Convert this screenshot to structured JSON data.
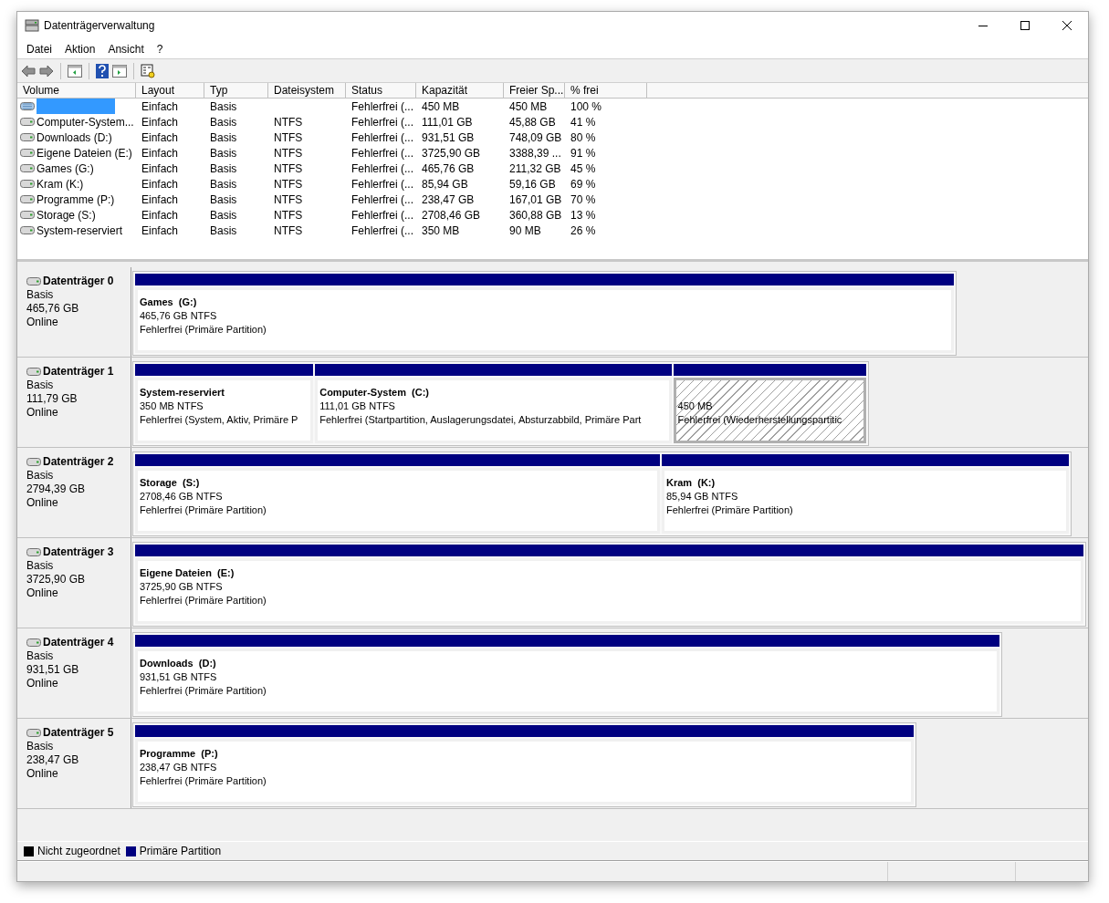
{
  "window": {
    "title": "Datenträgerverwaltung"
  },
  "menu": [
    "Datei",
    "Aktion",
    "Ansicht",
    "?"
  ],
  "volume_list": {
    "columns": [
      "Volume",
      "Layout",
      "Typ",
      "Dateisystem",
      "Status",
      "Kapazität",
      "Freier Sp...",
      "% frei"
    ],
    "rows": [
      {
        "selected": true,
        "kind": "recovery",
        "cells": [
          "",
          "Einfach",
          "Basis",
          "",
          "Fehlerfrei (...",
          "450 MB",
          "450 MB",
          "100 %"
        ]
      },
      {
        "selected": false,
        "kind": "drive",
        "cells": [
          "Computer-System...",
          "Einfach",
          "Basis",
          "NTFS",
          "Fehlerfrei (...",
          "111,01 GB",
          "45,88 GB",
          "41 %"
        ]
      },
      {
        "selected": false,
        "kind": "drive",
        "cells": [
          "Downloads (D:)",
          "Einfach",
          "Basis",
          "NTFS",
          "Fehlerfrei (...",
          "931,51 GB",
          "748,09 GB",
          "80 %"
        ]
      },
      {
        "selected": false,
        "kind": "drive",
        "cells": [
          "Eigene Dateien (E:)",
          "Einfach",
          "Basis",
          "NTFS",
          "Fehlerfrei (...",
          "3725,90 GB",
          "3388,39 ...",
          "91 %"
        ]
      },
      {
        "selected": false,
        "kind": "drive",
        "cells": [
          "Games (G:)",
          "Einfach",
          "Basis",
          "NTFS",
          "Fehlerfrei (...",
          "465,76 GB",
          "211,32 GB",
          "45 %"
        ]
      },
      {
        "selected": false,
        "kind": "drive",
        "cells": [
          "Kram (K:)",
          "Einfach",
          "Basis",
          "NTFS",
          "Fehlerfrei (...",
          "85,94 GB",
          "59,16 GB",
          "69 %"
        ]
      },
      {
        "selected": false,
        "kind": "drive",
        "cells": [
          "Programme (P:)",
          "Einfach",
          "Basis",
          "NTFS",
          "Fehlerfrei (...",
          "238,47 GB",
          "167,01 GB",
          "70 %"
        ]
      },
      {
        "selected": false,
        "kind": "drive",
        "cells": [
          "Storage (S:)",
          "Einfach",
          "Basis",
          "NTFS",
          "Fehlerfrei (...",
          "2708,46 GB",
          "360,88 GB",
          "13 %"
        ]
      },
      {
        "selected": false,
        "kind": "drive",
        "cells": [
          "System-reserviert",
          "Einfach",
          "Basis",
          "NTFS",
          "Fehlerfrei (...",
          "350 MB",
          "90 MB",
          "26 %"
        ]
      }
    ]
  },
  "disks": [
    {
      "name": "Datenträger 0",
      "type": "Basis",
      "size": "465,76 GB",
      "state": "Online",
      "partitions": [
        {
          "name": "Games  (G:)",
          "size": "465,76 GB NTFS",
          "status": "Fehlerfrei (Primäre Partition)",
          "selected": false
        }
      ]
    },
    {
      "name": "Datenträger 1",
      "type": "Basis",
      "size": "111,79 GB",
      "state": "Online",
      "partitions": [
        {
          "name": "System-reserviert",
          "size": "350 MB NTFS",
          "status": "Fehlerfrei (System, Aktiv, Primäre P",
          "selected": false
        },
        {
          "name": "Computer-System  (C:)",
          "size": "111,01 GB NTFS",
          "status": "Fehlerfrei (Startpartition, Auslagerungsdatei, Absturzabbild, Primäre Part",
          "selected": false
        },
        {
          "size": "450 MB",
          "status": "Fehlerfrei (Wiederherstellungspartitic",
          "selected": true
        }
      ]
    },
    {
      "name": "Datenträger 2",
      "type": "Basis",
      "size": "2794,39 GB",
      "state": "Online",
      "partitions": [
        {
          "name": "Storage  (S:)",
          "size": "2708,46 GB NTFS",
          "status": "Fehlerfrei (Primäre Partition)",
          "selected": false
        },
        {
          "name": "Kram  (K:)",
          "size": "85,94 GB NTFS",
          "status": "Fehlerfrei (Primäre Partition)",
          "selected": false
        }
      ]
    },
    {
      "name": "Datenträger 3",
      "type": "Basis",
      "size": "3725,90 GB",
      "state": "Online",
      "partitions": [
        {
          "name": "Eigene Dateien  (E:)",
          "size": "3725,90 GB NTFS",
          "status": "Fehlerfrei (Primäre Partition)",
          "selected": false
        }
      ]
    },
    {
      "name": "Datenträger 4",
      "type": "Basis",
      "size": "931,51 GB",
      "state": "Online",
      "partitions": [
        {
          "name": "Downloads  (D:)",
          "size": "931,51 GB NTFS",
          "status": "Fehlerfrei (Primäre Partition)",
          "selected": false
        }
      ]
    },
    {
      "name": "Datenträger 5",
      "type": "Basis",
      "size": "238,47 GB",
      "state": "Online",
      "partitions": [
        {
          "name": "Programme  (P:)",
          "size": "238,47 GB NTFS",
          "status": "Fehlerfrei (Primäre Partition)",
          "selected": false
        }
      ]
    }
  ],
  "legend": [
    {
      "label": "Nicht zugeordnet",
      "color": "#000000"
    },
    {
      "label": "Primäre Partition",
      "color": "#000080"
    }
  ]
}
